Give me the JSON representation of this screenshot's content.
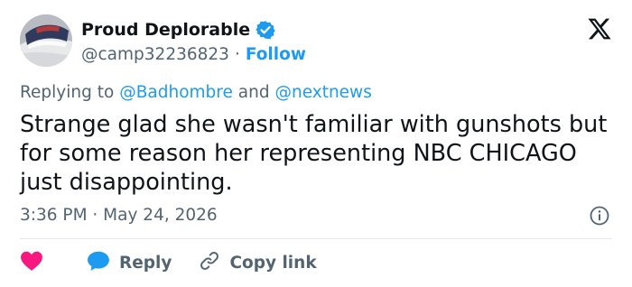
{
  "user": {
    "display_name": "Proud Deplorable",
    "handle": "@camp32236823",
    "separator": "·",
    "follow_label": "Follow"
  },
  "reply_context": {
    "prefix": "Replying to",
    "mention_1": "@Badhombre",
    "conjunction": "and",
    "mention_2": "@nextnews"
  },
  "tweet": {
    "lines": [
      "Strange glad she wasn't familiar with gunshots but",
      "for some reason her representing NBC CHICAGO",
      "just disappointing."
    ],
    "timestamp": "3:36 PM · May 24, 2026"
  },
  "actions": {
    "reply_label": "Reply",
    "copy_link_label": "Copy link"
  },
  "colors": {
    "accent": "#1d9bf0",
    "like": "#f91880",
    "secondary_text": "#536471",
    "primary_text": "#0f1419"
  },
  "icons": {
    "verified": "verified-badge-icon",
    "logo": "x-logo-icon",
    "info": "info-icon",
    "like": "heart-icon",
    "reply": "speech-bubble-icon",
    "copy_link": "link-icon"
  }
}
